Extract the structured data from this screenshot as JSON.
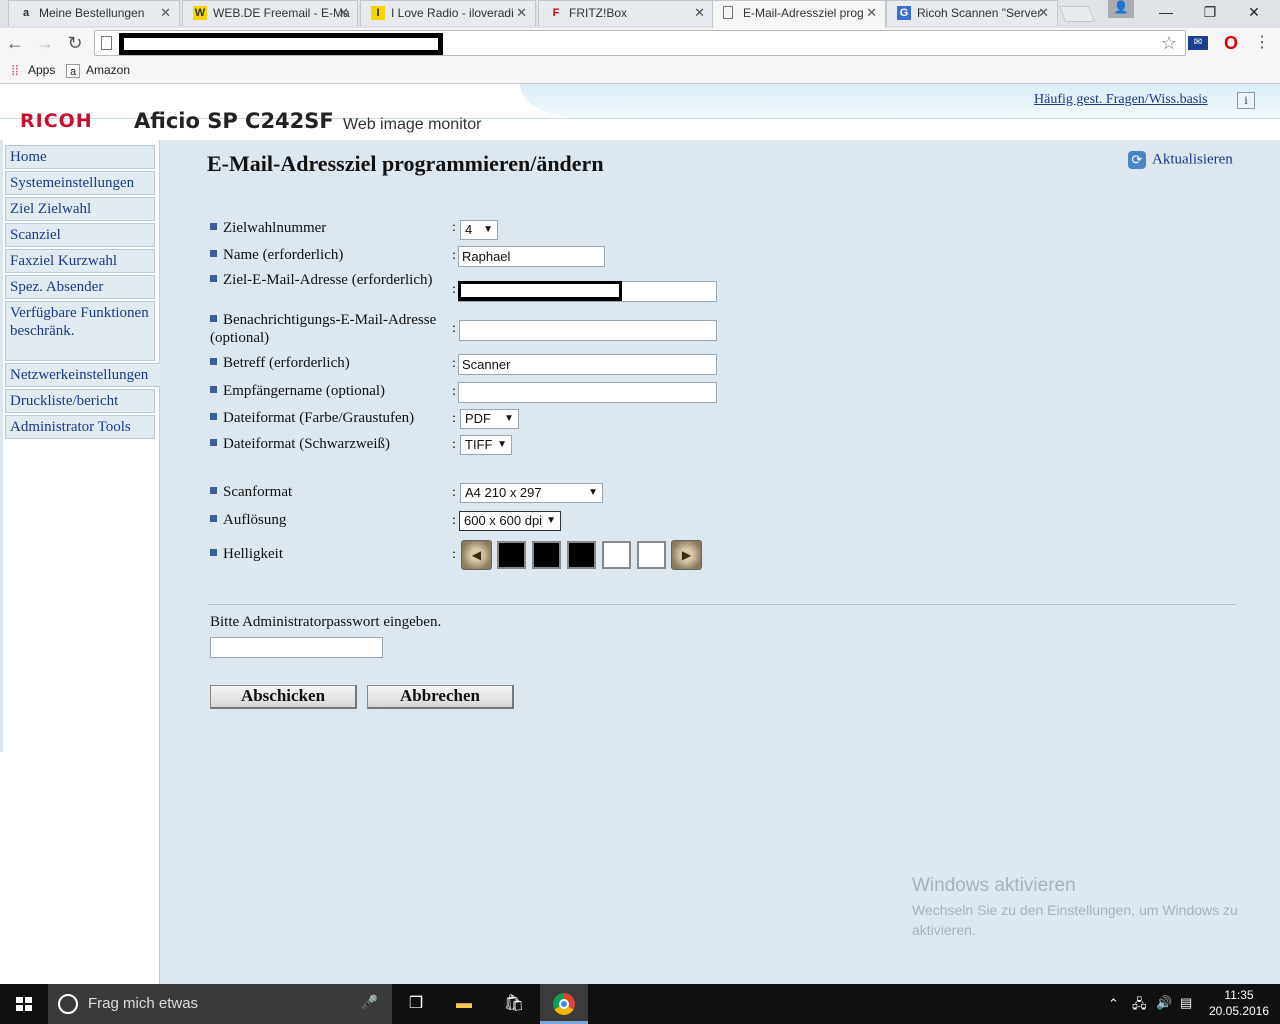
{
  "browser": {
    "tabs": [
      {
        "label": "Meine Bestellungen",
        "icon": "amazon-icon",
        "favicon_text": "a"
      },
      {
        "label": "WEB.DE Freemail - E-Ma",
        "icon": "webde-icon",
        "favicon_text": "W"
      },
      {
        "label": "I Love Radio - iloveradi",
        "icon": "iloveradio-icon",
        "favicon_text": "I"
      },
      {
        "label": "FRITZ!Box",
        "icon": "fritzbox-icon",
        "favicon_text": "F"
      },
      {
        "label": "E-Mail-Adressziel prog",
        "icon": "page-icon",
        "favicon_text": "",
        "active": true
      },
      {
        "label": "Ricoh Scannen \"Server",
        "icon": "google-icon",
        "favicon_text": "G"
      }
    ],
    "window_controls": {
      "minimize": "—",
      "maximize": "❐",
      "close": "✕"
    },
    "bookmarks": [
      {
        "label": "Apps",
        "icon": "apps-grid-icon"
      },
      {
        "label": "Amazon",
        "icon": "amazon-icon",
        "favicon_text": "a"
      }
    ]
  },
  "header": {
    "logo": "RICOH",
    "model": "Aficio SP C242SF",
    "subtitle": "Web image monitor",
    "faq_link": "Häufig gest. Fragen/Wiss.basis",
    "info_icon": "i"
  },
  "sidebar": {
    "items": [
      {
        "label": "Home"
      },
      {
        "label": "Systemeinstellungen"
      },
      {
        "label": "Ziel Zielwahl"
      },
      {
        "label": "Scanziel"
      },
      {
        "label": "Faxziel Kurzwahl"
      },
      {
        "label": "Spez. Absender"
      },
      {
        "label": "Verfügbare Funktionen beschränk."
      },
      {
        "label": "Netzwerkeinstellungen"
      },
      {
        "label": "Druckliste/bericht"
      },
      {
        "label": "Administrator Tools"
      }
    ]
  },
  "main": {
    "title": "E-Mail-Adressziel programmieren/ändern",
    "refresh_label": "Aktualisieren",
    "fields": {
      "zielwahlnummer": {
        "label": "Zielwahlnummer",
        "value": "4"
      },
      "name": {
        "label": "Name (erforderlich)",
        "value": "Raphael"
      },
      "ziel_email": {
        "label": "Ziel-E-Mail-Adresse (erforderlich)",
        "value": ""
      },
      "benachrichtigung": {
        "label": "Benachrichtigungs-E-Mail-Adresse (optional)",
        "value": ""
      },
      "betreff": {
        "label": "Betreff (erforderlich)",
        "value": "Scanner"
      },
      "empfaengername": {
        "label": "Empfängername (optional)",
        "value": ""
      },
      "dateiformat_farbe": {
        "label": "Dateiformat (Farbe/Graustufen)",
        "value": "PDF"
      },
      "dateiformat_sw": {
        "label": "Dateiformat (Schwarzweiß)",
        "value": "TIFF"
      },
      "scanformat": {
        "label": "Scanformat",
        "value": "A4 210 x 297"
      },
      "aufloesung": {
        "label": "Auflösung",
        "value": "600 x 600 dpi"
      },
      "helligkeit": {
        "label": "Helligkeit",
        "level": 3,
        "max": 5
      }
    },
    "colon": ":",
    "password_prompt": "Bitte Administratorpasswort eingeben.",
    "password_value": "",
    "submit_label": "Abschicken",
    "cancel_label": "Abbrechen"
  },
  "watermark": {
    "title": "Windows aktivieren",
    "text": "Wechseln Sie zu den Einstellungen, um Windows zu aktivieren."
  },
  "taskbar": {
    "search_placeholder": "Frag mich etwas",
    "time": "11:35",
    "date": "20.05.2016"
  }
}
